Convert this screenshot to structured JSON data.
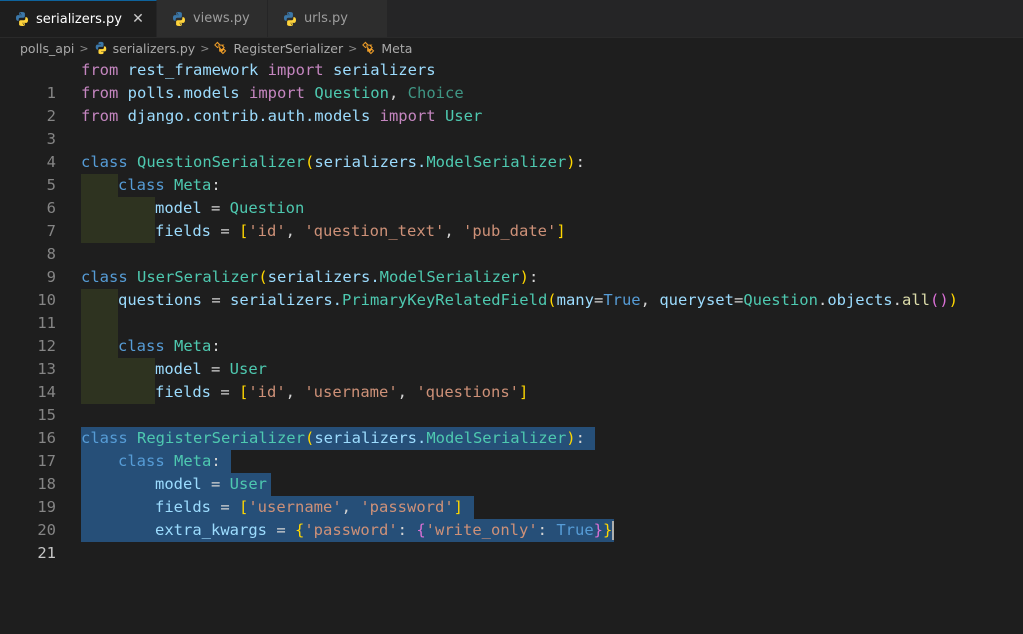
{
  "tabs": [
    {
      "label": "serializers.py",
      "active": true,
      "closable": true,
      "close_glyph": "✕"
    },
    {
      "label": "views.py",
      "active": false
    },
    {
      "label": "urls.py",
      "active": false
    }
  ],
  "breadcrumb": {
    "folder": "polls_api",
    "file": "serializers.py",
    "class_name": "RegisterSerializer",
    "member": "Meta"
  },
  "line_numbers": [
    "1",
    "2",
    "3",
    "4",
    "5",
    "6",
    "7",
    "8",
    "9",
    "10",
    "11",
    "12",
    "13",
    "14",
    "15",
    "16",
    "17",
    "18",
    "19",
    "20",
    "21"
  ],
  "current_line": "21",
  "code": {
    "l1": [
      "from",
      " rest_framework ",
      "import",
      " serializers"
    ],
    "l2": [
      "from",
      " polls.models ",
      "import",
      " Question",
      ", ",
      "Choice"
    ],
    "l3": [
      "from",
      " django.contrib.auth.models ",
      "import",
      " User"
    ],
    "l5": [
      "class",
      " QuestionSerializer",
      "(",
      "serializers.",
      "ModelSerializer",
      ")",
      ":"
    ],
    "l6": [
      "class",
      " Meta",
      ":"
    ],
    "l7": [
      "model",
      " = ",
      "Question"
    ],
    "l8": [
      "fields",
      " = ",
      "[",
      "'id'",
      ", ",
      "'question_text'",
      ", ",
      "'pub_date'",
      "]"
    ],
    "l10": [
      "class",
      " UserSeralizer",
      "(",
      "serializers.",
      "ModelSerializer",
      ")",
      ":"
    ],
    "l11": [
      "questions",
      " = ",
      "serializers.",
      "PrimaryKeyRelatedField",
      "(",
      "many",
      "=",
      "True",
      ", ",
      "queryset",
      "=",
      "Question",
      ".",
      "objects",
      ".",
      "all",
      "()",
      ")"
    ],
    "l13": [
      "class",
      " Meta",
      ":"
    ],
    "l14": [
      "model",
      " = ",
      "User"
    ],
    "l15": [
      "fields",
      " = ",
      "[",
      "'id'",
      ", ",
      "'username'",
      ", ",
      "'questions'",
      "]"
    ],
    "l17": [
      "class",
      " RegisterSerializer",
      "(",
      "serializers.",
      "ModelSerializer",
      ")",
      ":"
    ],
    "l18": [
      "class",
      " Meta",
      ":"
    ],
    "l19": [
      "model",
      " = ",
      "User"
    ],
    "l20": [
      "fields",
      " = ",
      "[",
      "'username'",
      ", ",
      "'password'",
      "]"
    ],
    "l21": [
      "extra_kwargs",
      " = ",
      "{",
      "'password'",
      ": ",
      "{",
      "'write_only'",
      ": ",
      "True",
      "}",
      "}"
    ]
  },
  "colors": {
    "background": "#1e1e1e",
    "selection": "#264f78",
    "keyword": "#c586c0",
    "storage": "#569cd6",
    "class": "#4ec9b0",
    "variable": "#9cdcfe",
    "string": "#ce9178",
    "function": "#dcdcaa"
  }
}
